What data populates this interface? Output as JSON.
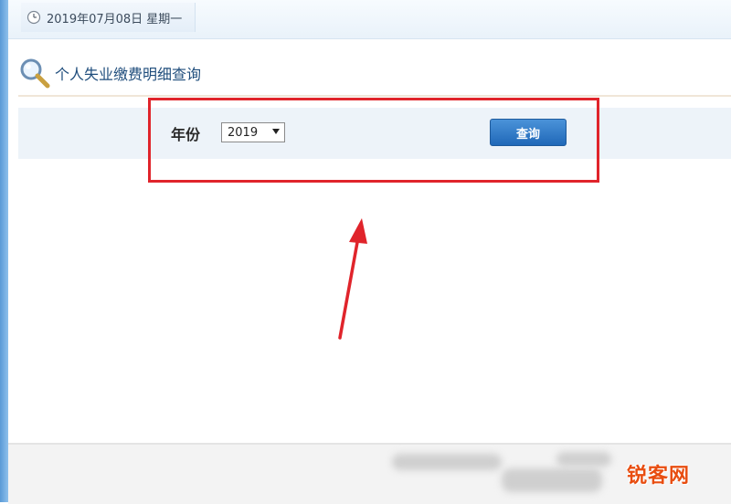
{
  "header": {
    "date_text": "2019年07月08日 星期一"
  },
  "page": {
    "title": "个人失业缴费明细查询"
  },
  "form": {
    "year_label": "年份",
    "year_value": "2019",
    "query_button_label": "查询"
  },
  "watermark": {
    "text": "锐客网"
  },
  "colors": {
    "highlight_box": "#e0242b",
    "button": "#2068b8",
    "title": "#1f4d7c",
    "watermark": "#e84d10"
  },
  "icons": {
    "date": "clock-icon",
    "title": "search-icon",
    "select": "caret-down-icon",
    "annotation": "arrow-icon"
  }
}
